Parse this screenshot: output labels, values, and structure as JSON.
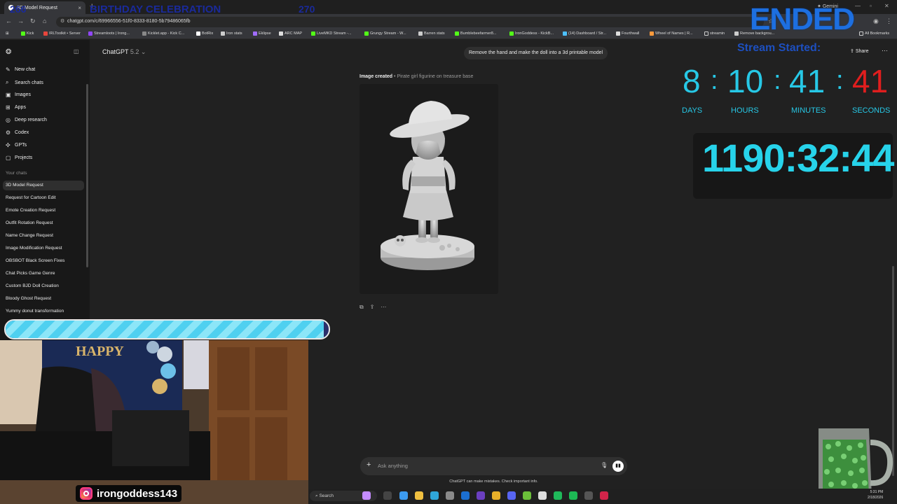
{
  "browser": {
    "tab_title": "3D Model Request",
    "new_tab": "+",
    "gemini_label": "Gemini",
    "url": "chatgpt.com/c/69966556-51f0-8333-8180-5b79486065fb",
    "bookmarks": [
      "Kick",
      "IRLToolkit • Server",
      "Streamloots | Irong...",
      "Kicklet.app - Kick C...",
      "BotRix",
      "Iron stats",
      "Eklipse",
      "ARC MAP",
      "LiveMKD Stream -...",
      "Grungy Stream - W...",
      "Barren stats",
      "Bumblebeefarmer8...",
      "IronGoddess - KickB...",
      "(14) Dashboard / Str...",
      "Fourthwall",
      "Wheel of Names | R...",
      "streamin",
      "Remove backgrou...",
      "All Bookmarks"
    ]
  },
  "sidebar": {
    "items": [
      {
        "label": "New chat",
        "icon": "✎"
      },
      {
        "label": "Search chats",
        "icon": "⌕"
      },
      {
        "label": "Images",
        "icon": "▣"
      },
      {
        "label": "Apps",
        "icon": "⊞"
      },
      {
        "label": "Deep research",
        "icon": "◎"
      },
      {
        "label": "Codex",
        "icon": "⚙"
      },
      {
        "label": "GPTs",
        "icon": "✣"
      },
      {
        "label": "Projects",
        "icon": "▢"
      }
    ],
    "section_label": "Your chats",
    "chats": [
      "3D Model Request",
      "Request for Cartoon Edit",
      "Emote Creation Request",
      "Outfit Rotation Request",
      "Name Change Request",
      "Image Modification Request",
      "OBSBOT Black Screen Fixes",
      "Chat Picks Game Genre",
      "Custom BJD Doll Creation",
      "Bloody Ghost Request",
      "Yummy donut transformation"
    ]
  },
  "chat": {
    "model_name": "ChatGPT",
    "model_version": "5.2",
    "user_message": "Remove the hand and make the doll into a 3d printable model",
    "share_label": "Share",
    "image_status": "Image created",
    "image_caption": "• Pirate girl figurine on treasure base",
    "composer_placeholder": "Ask anything",
    "disclaimer": "ChatGPT can make mistakes. Check important info."
  },
  "overlay": {
    "ended": "ENDED",
    "stream_started": "Stream Started:",
    "countdown": {
      "days": "8",
      "hours": "10",
      "minutes": "41",
      "seconds": "41",
      "sep": ":"
    },
    "countdown_labels": {
      "days": "DAYS",
      "hours": "HOURS",
      "minutes": "MINUTES",
      "seconds": "SECONDS"
    },
    "uptime": "1190:32:44",
    "goal": {
      "current": "266",
      "title": "BIRTHDAY CELEBRATION",
      "target": "270",
      "progress_fraction": 0.985
    },
    "instagram_handle": "irongoddess143"
  },
  "taskbar": {
    "search_label": "Search",
    "time": "5:31 PM",
    "date": "2/18/2026"
  },
  "colors": {
    "countdown": "#27c8e6",
    "seconds": "#e01e1e",
    "ended": "#1d6fe0"
  }
}
